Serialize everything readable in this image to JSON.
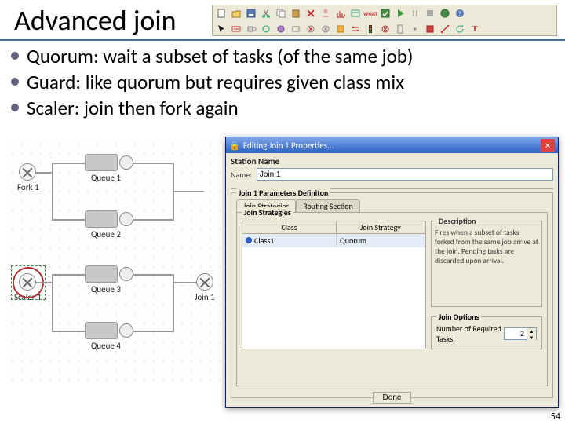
{
  "slide": {
    "title": "Advanced join",
    "page_number": "54"
  },
  "bullets": [
    "Quorum: wait a subset of tasks (of the same job)",
    "Guard: like quorum but requires given class mix",
    "Scaler: join then fork again"
  ],
  "diagram": {
    "nodes": {
      "fork1": "Fork 1",
      "queue1": "Queue 1",
      "queue2": "Queue 2",
      "queue3": "Queue 3",
      "queue4": "Queue 4",
      "scaler1": "Scaler 1",
      "join": "Join 1"
    }
  },
  "dialog": {
    "title": "Editing Join 1 Properties...",
    "section_station_name": "Station Name",
    "name_label": "Name:",
    "name_value": "Join 1",
    "group_title": "Join 1 Parameters Definiton",
    "tab1": "Join Strategies",
    "tab2": "Routing Section",
    "inner_title": "Join Strategies",
    "col_class": "Class",
    "col_strategy": "Join Strategy",
    "row_class": "Class1",
    "row_strategy": "Quorum",
    "desc_title": "Description",
    "desc_text": "Fires when a subset of tasks forked from the same job arrive at the join. Pending tasks are discarded upon arrival.",
    "opt_title": "Join Options",
    "opt_label": "Number of Required Tasks:",
    "opt_value": "2",
    "done": "Done"
  }
}
